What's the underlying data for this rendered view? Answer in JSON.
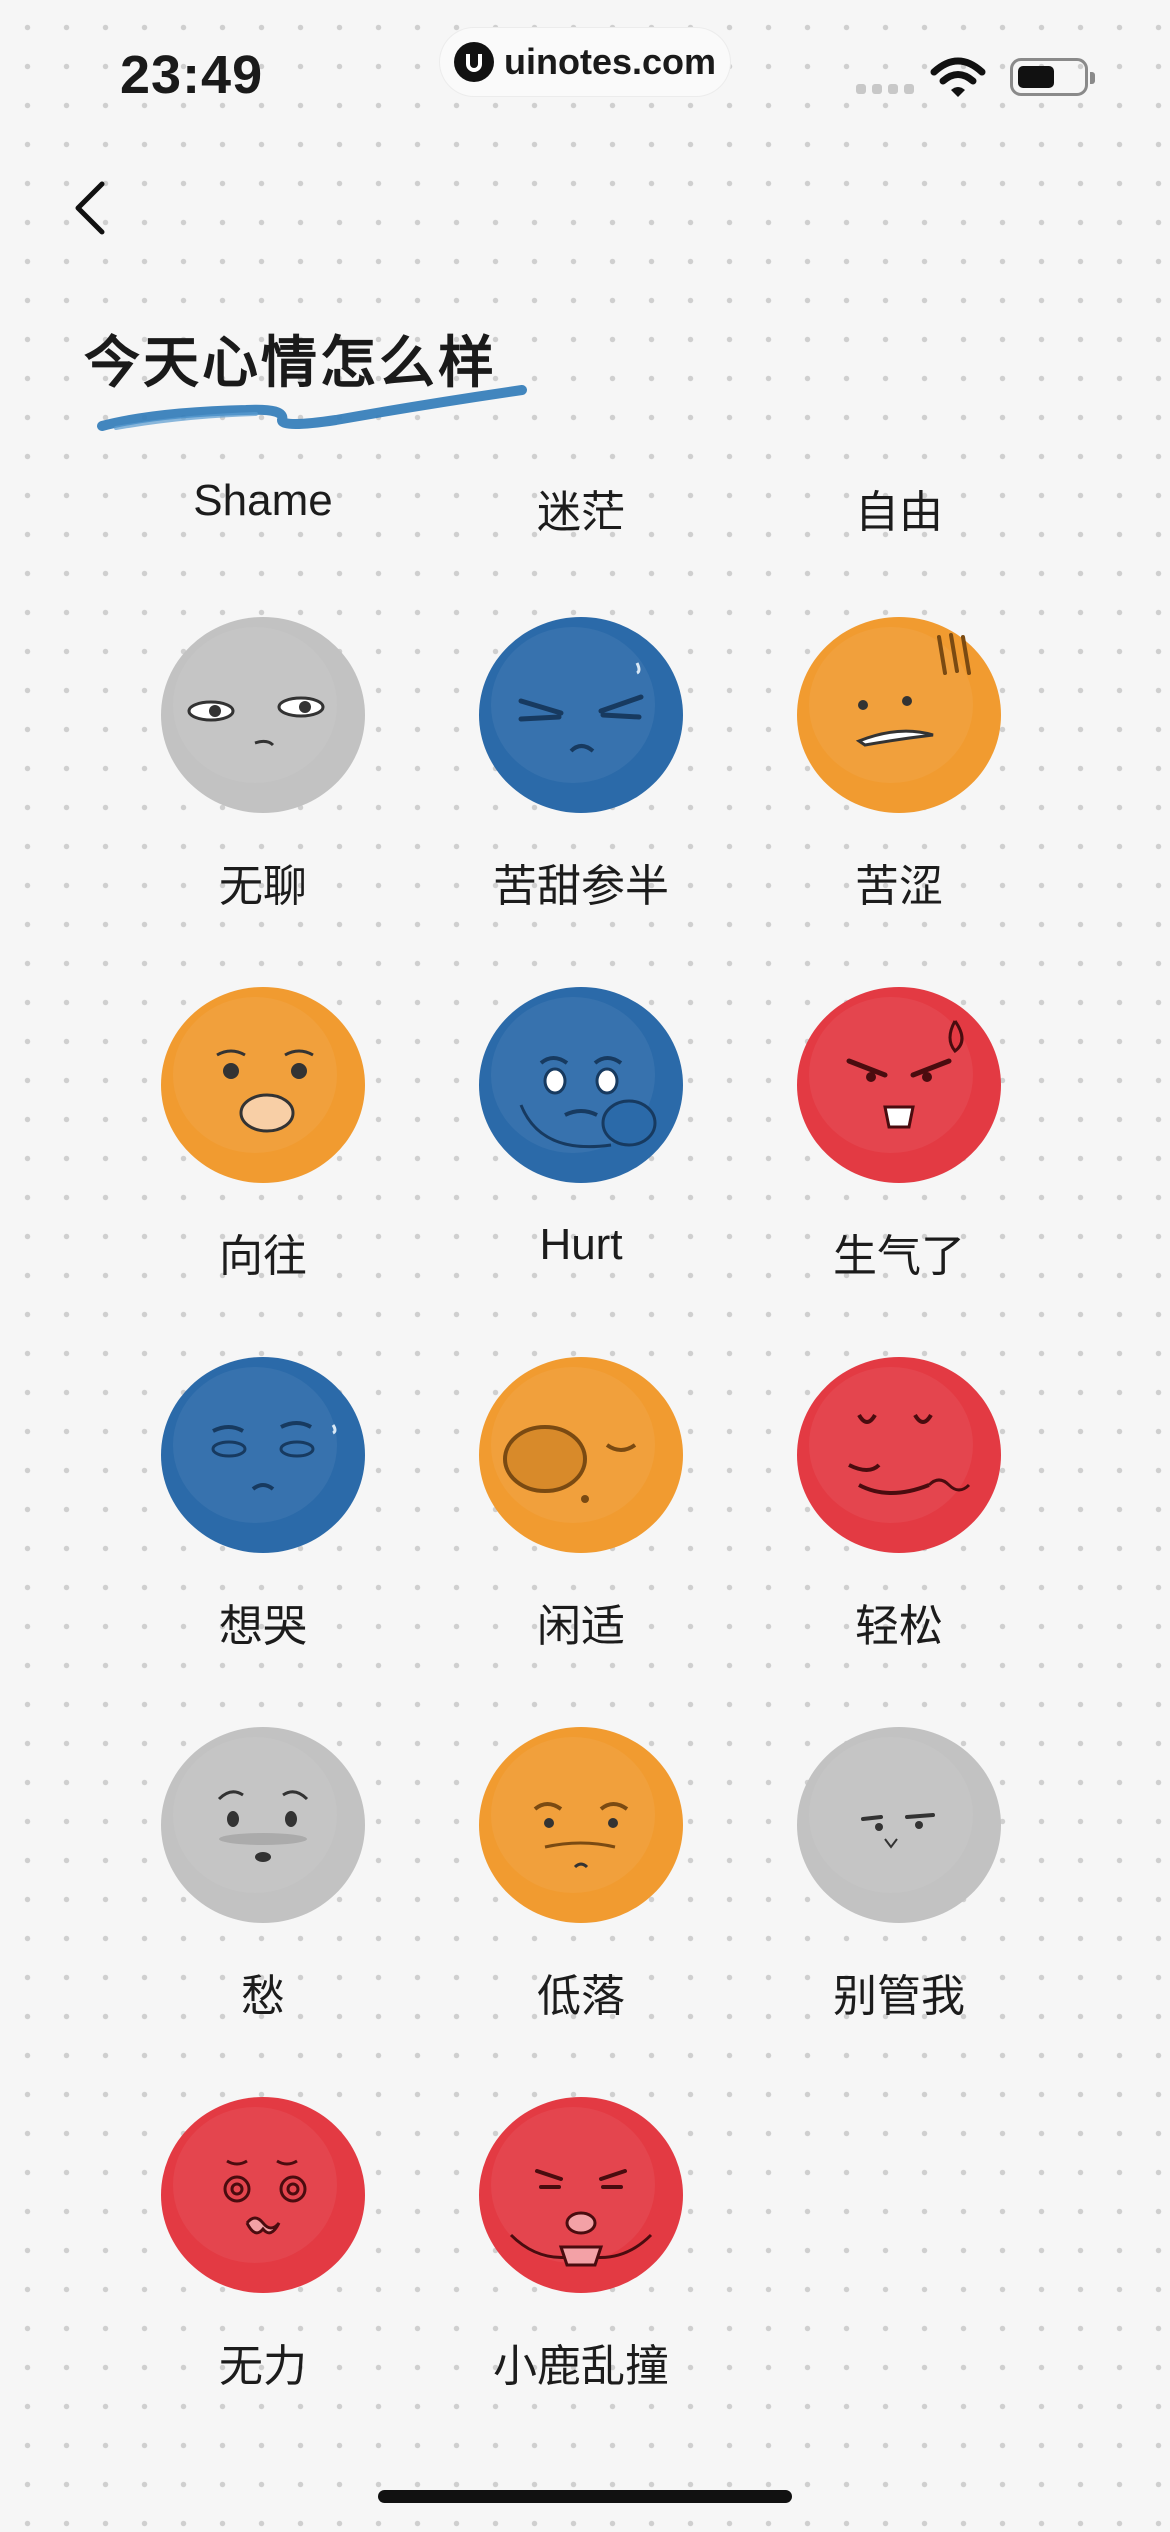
{
  "status": {
    "time": "23:49",
    "url": "uinotes.com"
  },
  "page": {
    "title": "今天心情怎么样"
  },
  "colors": {
    "gray": "#c2c2c2",
    "blue": "#2b6aa9",
    "orange": "#f19b30",
    "red": "#e33a43",
    "brush": "#2f7ab8"
  },
  "top_labels": [
    "Shame",
    "迷茫",
    "自由"
  ],
  "moods": [
    {
      "label": "无聊",
      "color": "gray",
      "icon": "bored-face-icon"
    },
    {
      "label": "苦甜参半",
      "color": "blue",
      "icon": "bittersweet-face-icon"
    },
    {
      "label": "苦涩",
      "color": "orange",
      "icon": "bitter-face-icon"
    },
    {
      "label": "向往",
      "color": "orange",
      "icon": "yearning-face-icon"
    },
    {
      "label": "Hurt",
      "color": "blue",
      "icon": "hurt-face-icon"
    },
    {
      "label": "生气了",
      "color": "red",
      "icon": "angry-face-icon"
    },
    {
      "label": "想哭",
      "color": "blue",
      "icon": "want-to-cry-face-icon"
    },
    {
      "label": "闲适",
      "color": "orange",
      "icon": "leisurely-face-icon"
    },
    {
      "label": "轻松",
      "color": "red",
      "icon": "relaxed-face-icon"
    },
    {
      "label": "愁",
      "color": "gray",
      "icon": "worried-face-icon"
    },
    {
      "label": "低落",
      "color": "orange",
      "icon": "down-face-icon"
    },
    {
      "label": "别管我",
      "color": "gray",
      "icon": "leave-me-alone-face-icon"
    },
    {
      "label": "无力",
      "color": "red",
      "icon": "powerless-face-icon"
    },
    {
      "label": "小鹿乱撞",
      "color": "red",
      "icon": "heart-racing-face-icon"
    }
  ]
}
